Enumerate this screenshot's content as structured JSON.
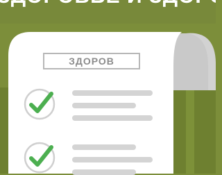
{
  "header": {
    "cut_off_text": "ЗДОРОВЬЕ И ЗДОРОВЬЕ"
  },
  "document": {
    "title": "ЗДОРОВ"
  },
  "checklist": [
    {
      "icon": "checkmark-icon",
      "state": "checked",
      "color": "#4caf50"
    },
    {
      "icon": "checkmark-icon",
      "state": "checked",
      "color": "#4caf50"
    }
  ],
  "colors": {
    "background": "#7c8e3a",
    "lower_background": "#6e8030",
    "paper": "#ffffff",
    "scroll_curl": "#d2d2d2",
    "check": "#4caf50",
    "placeholder_line": "#d4d4d4"
  }
}
